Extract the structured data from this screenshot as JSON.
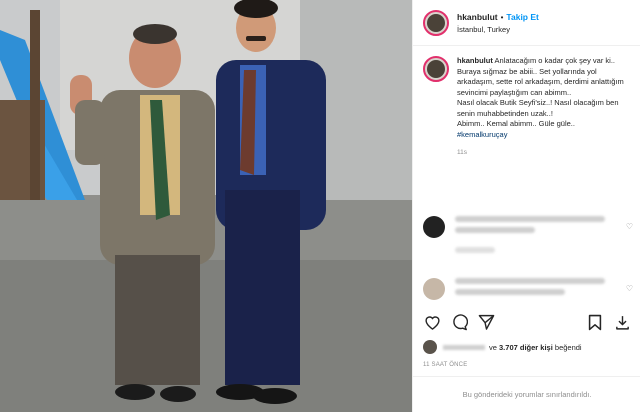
{
  "header": {
    "username": "hkanbulut",
    "separator": "•",
    "follow_label": "Takip Et",
    "location": "İstanbul, Turkey"
  },
  "caption": {
    "username": "hkanbulut",
    "text": "Anlatacağım o kadar çok şey var ki.. Buraya sığmaz be abiii.. Set yollarında yol arkadaşım, sette rol arkadaşım, derdimi anlattığım sevincimi paylaştığım can abimm..",
    "line2": "Nasıl olacak Butik Seyfi'siz..! Nasıl olacağım ben senin muhabbetinden uzak..!",
    "line3": "Abimm.. Kemal abimm.. Güle güle..",
    "hashtag": "#kemalkuruçay",
    "time_ago": "11s"
  },
  "likes": {
    "prefix": "ve",
    "count_text": "3.707 diğer kişi",
    "suffix": "beğendi"
  },
  "timestamp": "11 SAAT ÖNCE",
  "footer": "Bu gönderideki yorumlar sınırlandırıldı.",
  "icons": [
    "heart-icon",
    "comment-icon",
    "share-icon",
    "bookmark-icon",
    "download-icon"
  ],
  "colors": {
    "follow": "#0095f6",
    "hashtag": "#00376b",
    "muted": "#8e8e8e"
  }
}
